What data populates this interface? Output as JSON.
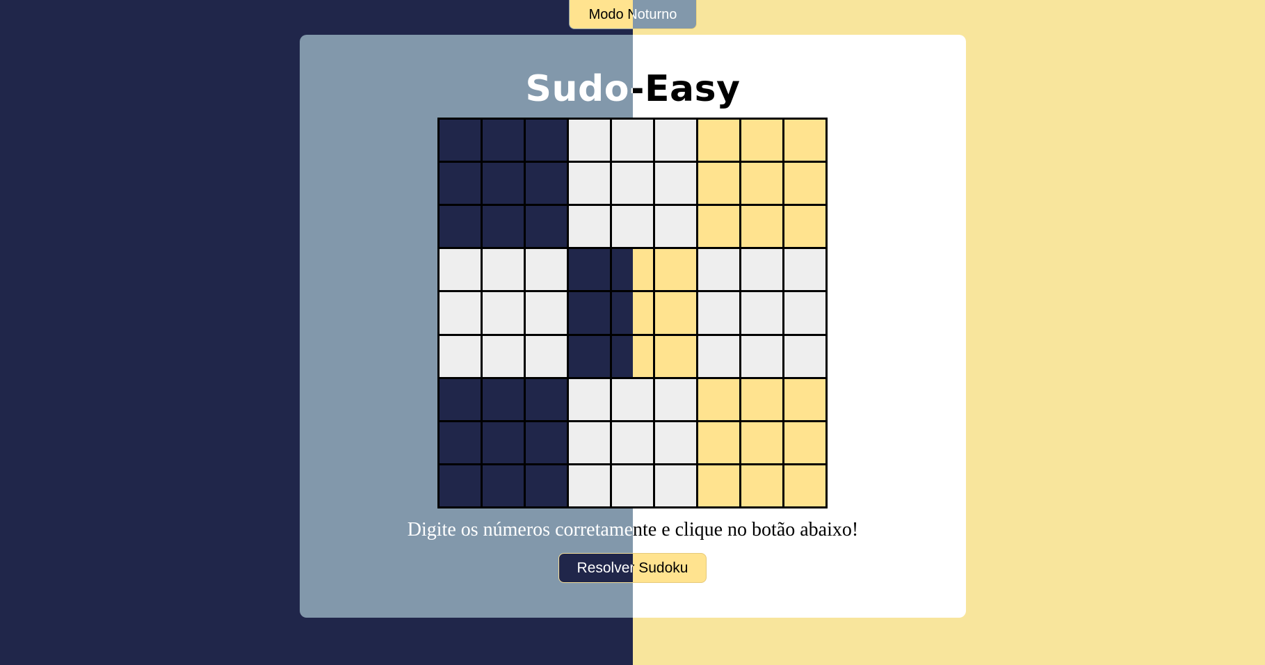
{
  "mode_button": {
    "label": "Modo Noturno"
  },
  "app": {
    "title": "Sudo-Easy"
  },
  "board": {
    "size": 9,
    "cells": [
      [
        "",
        "",
        "",
        "",
        "",
        "",
        "",
        "",
        ""
      ],
      [
        "",
        "",
        "",
        "",
        "",
        "",
        "",
        "",
        ""
      ],
      [
        "",
        "",
        "",
        "",
        "",
        "",
        "",
        "",
        ""
      ],
      [
        "",
        "",
        "",
        "",
        "",
        "",
        "",
        "",
        ""
      ],
      [
        "",
        "",
        "",
        "",
        "",
        "",
        "",
        "",
        ""
      ],
      [
        "",
        "",
        "",
        "",
        "",
        "",
        "",
        "",
        ""
      ],
      [
        "",
        "",
        "",
        "",
        "",
        "",
        "",
        "",
        ""
      ],
      [
        "",
        "",
        "",
        "",
        "",
        "",
        "",
        "",
        ""
      ],
      [
        "",
        "",
        "",
        "",
        "",
        "",
        "",
        "",
        ""
      ]
    ]
  },
  "instruction": "Digite os números corretamente e clique no botão abaixo!",
  "solve_button": {
    "label": "Resolver Sudoku"
  },
  "colors": {
    "night_background": "#20264a",
    "night_card": "#8298ab",
    "day_background": "#f8e59c",
    "day_card": "#ffffff",
    "box_dark": "#20264a",
    "box_light": "#eeeeee",
    "box_yellow": "#ffe38f"
  }
}
